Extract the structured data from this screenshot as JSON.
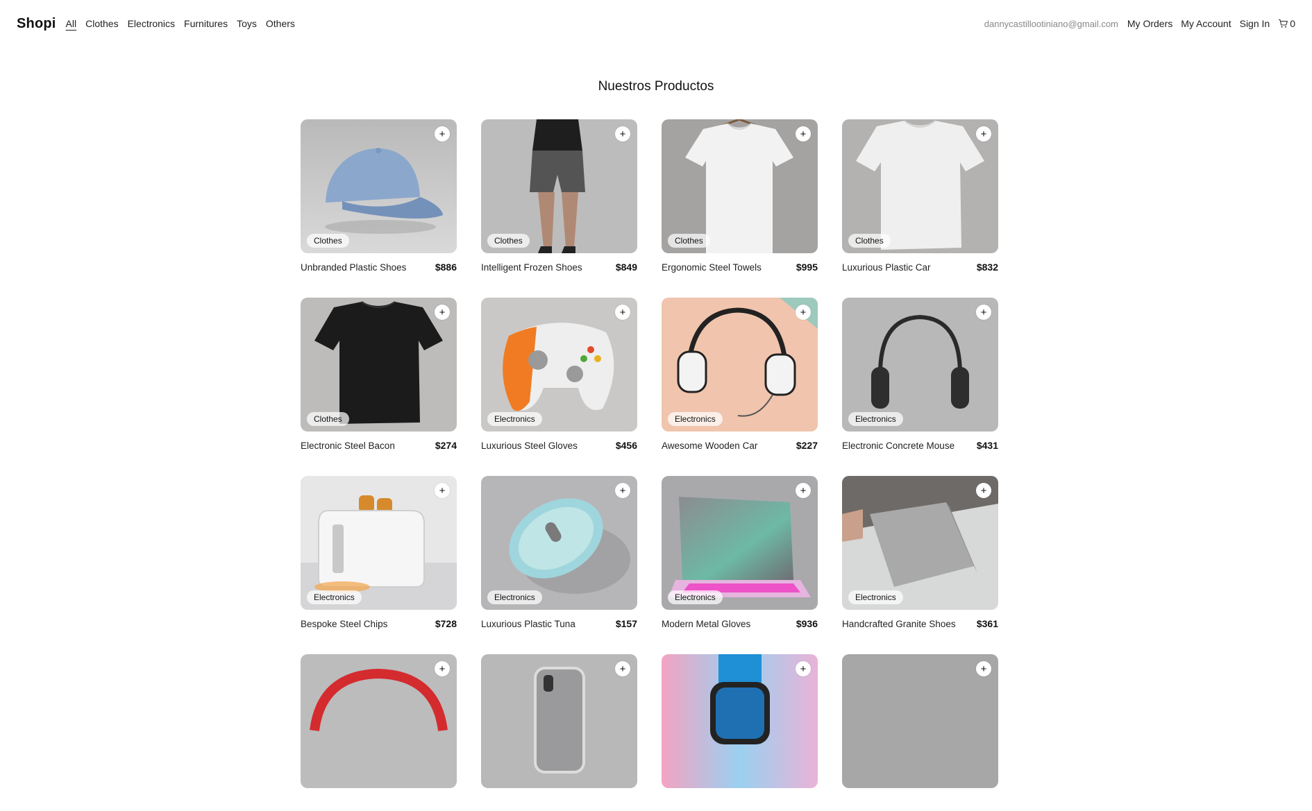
{
  "brand": "Shopi",
  "nav": {
    "categories": [
      "All",
      "Clothes",
      "Electronics",
      "Furnitures",
      "Toys",
      "Others"
    ],
    "email": "dannycastillootiniano@gmail.com",
    "my_orders": "My Orders",
    "my_account": "My Account",
    "sign_in": "Sign In",
    "cart_count": "0"
  },
  "heading": "Nuestros Productos",
  "add_symbol": "+",
  "products": [
    {
      "name": "Unbranded Plastic Shoes",
      "price": "$886",
      "category": "Clothes",
      "image": "blue-cap"
    },
    {
      "name": "Intelligent Frozen Shoes",
      "price": "$849",
      "category": "Clothes",
      "image": "shorts-model"
    },
    {
      "name": "Ergonomic Steel Towels",
      "price": "$995",
      "category": "Clothes",
      "image": "white-tshirt-hanger"
    },
    {
      "name": "Luxurious Plastic Car",
      "price": "$832",
      "category": "Clothes",
      "image": "white-tshirt"
    },
    {
      "name": "Electronic Steel Bacon",
      "price": "$274",
      "category": "Clothes",
      "image": "black-tshirt"
    },
    {
      "name": "Luxurious Steel Gloves",
      "price": "$456",
      "category": "Electronics",
      "image": "game-controller"
    },
    {
      "name": "Awesome Wooden Car",
      "price": "$227",
      "category": "Electronics",
      "image": "white-headphones"
    },
    {
      "name": "Electronic Concrete Mouse",
      "price": "$431",
      "category": "Electronics",
      "image": "black-headphones"
    },
    {
      "name": "Bespoke Steel Chips",
      "price": "$728",
      "category": "Electronics",
      "image": "toaster"
    },
    {
      "name": "Luxurious Plastic Tuna",
      "price": "$157",
      "category": "Electronics",
      "image": "mouse"
    },
    {
      "name": "Modern Metal Gloves",
      "price": "$936",
      "category": "Electronics",
      "image": "laptop-neon"
    },
    {
      "name": "Handcrafted Granite Shoes",
      "price": "$361",
      "category": "Electronics",
      "image": "laptop-silver"
    },
    {
      "name": "",
      "price": "",
      "category": "",
      "image": "red-headphones"
    },
    {
      "name": "",
      "price": "",
      "category": "",
      "image": "phone"
    },
    {
      "name": "",
      "price": "",
      "category": "",
      "image": "smartwatch"
    },
    {
      "name": "",
      "price": "",
      "category": "",
      "image": "gray-product"
    }
  ]
}
